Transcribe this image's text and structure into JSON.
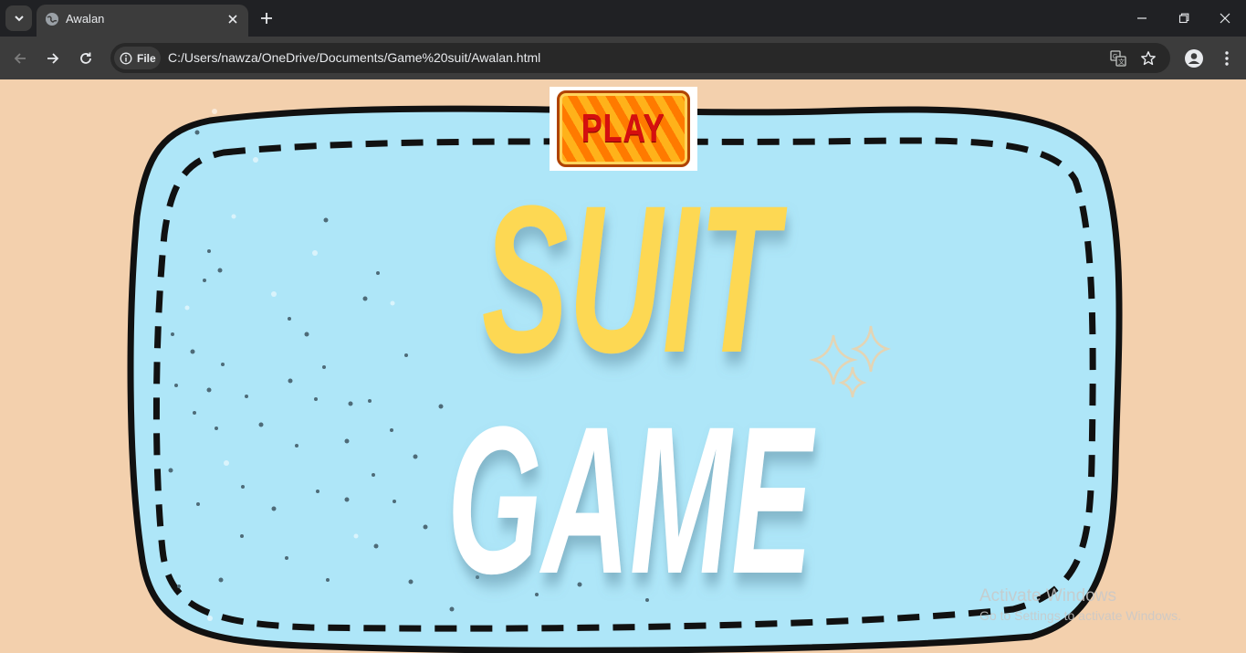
{
  "browser": {
    "tab": {
      "title": "Awalan"
    },
    "address": {
      "scheme_chip": "File",
      "url": "C:/Users/nawza/OneDrive/Documents/Game%20suit/Awalan.html"
    }
  },
  "page": {
    "play_button_label": "PLAY",
    "title_line1": "SUIT",
    "title_line2": "GAME",
    "colors": {
      "background": "#f3d0ad",
      "panel": "#aee6f8",
      "title_yellow": "#fdd853",
      "title_white": "#ffffff"
    }
  },
  "watermark": {
    "title": "Activate Windows",
    "subtitle": "Go to Settings to activate Windows."
  }
}
